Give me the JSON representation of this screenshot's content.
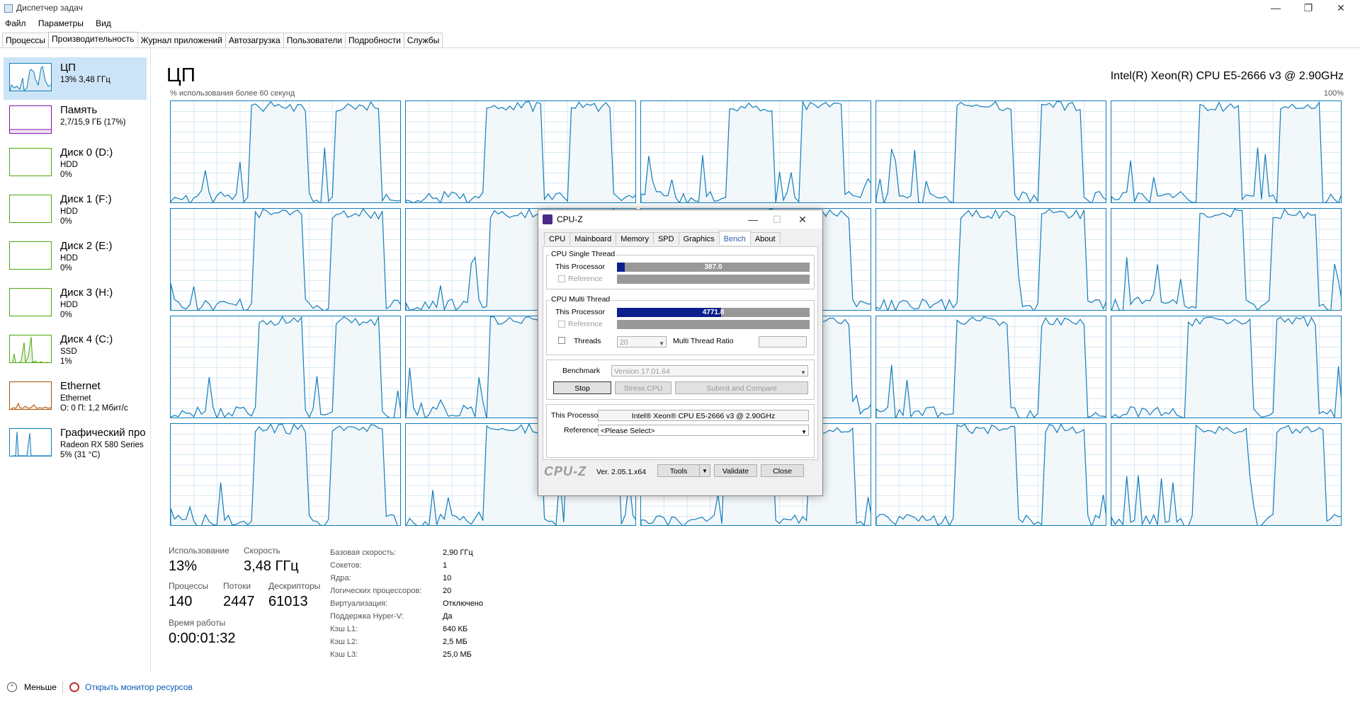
{
  "window": {
    "title": "Диспетчер задач",
    "min": "—",
    "restore": "❐",
    "close": "✕"
  },
  "menu": [
    "Файл",
    "Параметры",
    "Вид"
  ],
  "tabs": [
    {
      "label": "Процессы",
      "active": false
    },
    {
      "label": "Производительность",
      "active": true
    },
    {
      "label": "Журнал приложений",
      "active": false
    },
    {
      "label": "Автозагрузка",
      "active": false
    },
    {
      "label": "Пользователи",
      "active": false
    },
    {
      "label": "Подробности",
      "active": false
    },
    {
      "label": "Службы",
      "active": false
    }
  ],
  "sidebar": [
    {
      "name": "ЦП",
      "lines": [
        "13% 3,48 ГГц"
      ],
      "color": "#117dbb",
      "selected": true
    },
    {
      "name": "Память",
      "lines": [
        "2,7/15,9 ГБ (17%)"
      ],
      "color": "#8b12ae",
      "selected": false
    },
    {
      "name": "Диск 0 (D:)",
      "lines": [
        "HDD",
        "0%"
      ],
      "color": "#4da60c",
      "selected": false
    },
    {
      "name": "Диск 1 (F:)",
      "lines": [
        "HDD",
        "0%"
      ],
      "color": "#4da60c",
      "selected": false
    },
    {
      "name": "Диск 2 (E:)",
      "lines": [
        "HDD",
        "0%"
      ],
      "color": "#4da60c",
      "selected": false
    },
    {
      "name": "Диск 3 (H:)",
      "lines": [
        "HDD",
        "0%"
      ],
      "color": "#4da60c",
      "selected": false
    },
    {
      "name": "Диск 4 (C:)",
      "lines": [
        "SSD",
        "1%"
      ],
      "color": "#4da60c",
      "selected": false
    },
    {
      "name": "Ethernet",
      "lines": [
        "Ethernet",
        "О: 0 П: 1,2 Мбит/с"
      ],
      "color": "#a74f01",
      "selected": false
    },
    {
      "name": "Графический про",
      "lines": [
        "Radeon RX 580 Series",
        "5% (31 °C)"
      ],
      "color": "#117dbb",
      "selected": false
    }
  ],
  "main": {
    "title": "ЦП",
    "cpu_model": "Intel(R) Xeon(R) CPU E5-2666 v3 @ 2.90GHz",
    "usage_label": "% использования более 60 секунд",
    "pct_max": "100%"
  },
  "stats": {
    "usage_label": "Использование",
    "usage": "13%",
    "speed_label": "Скорость",
    "speed": "3,48 ГГц",
    "processes_label": "Процессы",
    "processes": "140",
    "threads_label": "Потоки",
    "threads": "2447",
    "handles_label": "Дескрипторы",
    "handles": "61013",
    "uptime_label": "Время работы",
    "uptime": "0:00:01:32"
  },
  "specs": [
    {
      "label": "Базовая скорость:",
      "value": "2,90 ГГц"
    },
    {
      "label": "Сокетов:",
      "value": "1"
    },
    {
      "label": "Ядра:",
      "value": "10"
    },
    {
      "label": "Логических процессоров:",
      "value": "20"
    },
    {
      "label": "Виртуализация:",
      "value": "Отключено"
    },
    {
      "label": "Поддержка Hyper-V:",
      "value": "Да"
    },
    {
      "label": "Кэш L1:",
      "value": "640 КБ"
    },
    {
      "label": "Кэш L2:",
      "value": "2,5 МБ"
    },
    {
      "label": "Кэш L3:",
      "value": "25,0 МБ"
    }
  ],
  "footer": {
    "less": "Меньше",
    "monitor_link": "Открыть монитор ресурсов"
  },
  "cpuz": {
    "title": "CPU-Z",
    "tabs": [
      "CPU",
      "Mainboard",
      "Memory",
      "SPD",
      "Graphics",
      "Bench",
      "About"
    ],
    "active_tab": "Bench",
    "single_title": "CPU Single Thread",
    "multi_title": "CPU Multi Thread",
    "this_processor": "This Processor",
    "reference": "Reference",
    "single_value": "387.0",
    "single_fraction": 0.04,
    "multi_value": "4771.8",
    "multi_fraction": 0.54,
    "threads_label": "Threads",
    "threads_value": "20",
    "ratio_label": "Multi Thread Ratio",
    "benchmark_label": "Benchmark",
    "benchmark_version": "Version 17.01.64",
    "btn_stop": "Stop",
    "btn_stress": "Stress CPU",
    "btn_submit": "Submit and Compare",
    "proc_label": "This Processor",
    "proc_value": "Intel® Xeon® CPU E5-2666 v3 @ 2.90GHz",
    "ref_label": "Reference",
    "ref_value": "<Please Select>",
    "logo": "CPU-Z",
    "version": "Ver. 2.05.1.x64",
    "btn_tools": "Tools",
    "btn_validate": "Validate",
    "btn_close": "Close"
  },
  "colors": {
    "cpu_line": "#117dbb",
    "cpu_fill": "#f1f6fa",
    "grid": "#d9eaf4",
    "selected_bg": "#cce4f7",
    "cpuz_bar": "#0d1f8c"
  }
}
